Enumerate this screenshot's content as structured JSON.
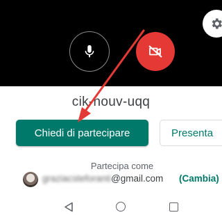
{
  "preview": {
    "mic_icon": "mic-icon",
    "camera_off_icon": "camera-off-icon",
    "settings_icon": "gear-icon",
    "camera_button_color": "#e53935"
  },
  "meeting": {
    "code": "cik-nouv-uqq"
  },
  "actions": {
    "join_label": "Chiedi di partecipare",
    "present_label": "Presenta",
    "join_color": "#00796b"
  },
  "account": {
    "join_as_label": "Partecipa come",
    "email_hidden_part": "graziacsteforanti",
    "email_visible_part": "@gmail.com",
    "change_label": "(Cambia)"
  },
  "navbar": {
    "back_icon": "back-triangle-icon",
    "home_icon": "home-circle-icon",
    "recents_icon": "recents-square-icon"
  },
  "annotation": {
    "arrow_color": "#e53935"
  }
}
